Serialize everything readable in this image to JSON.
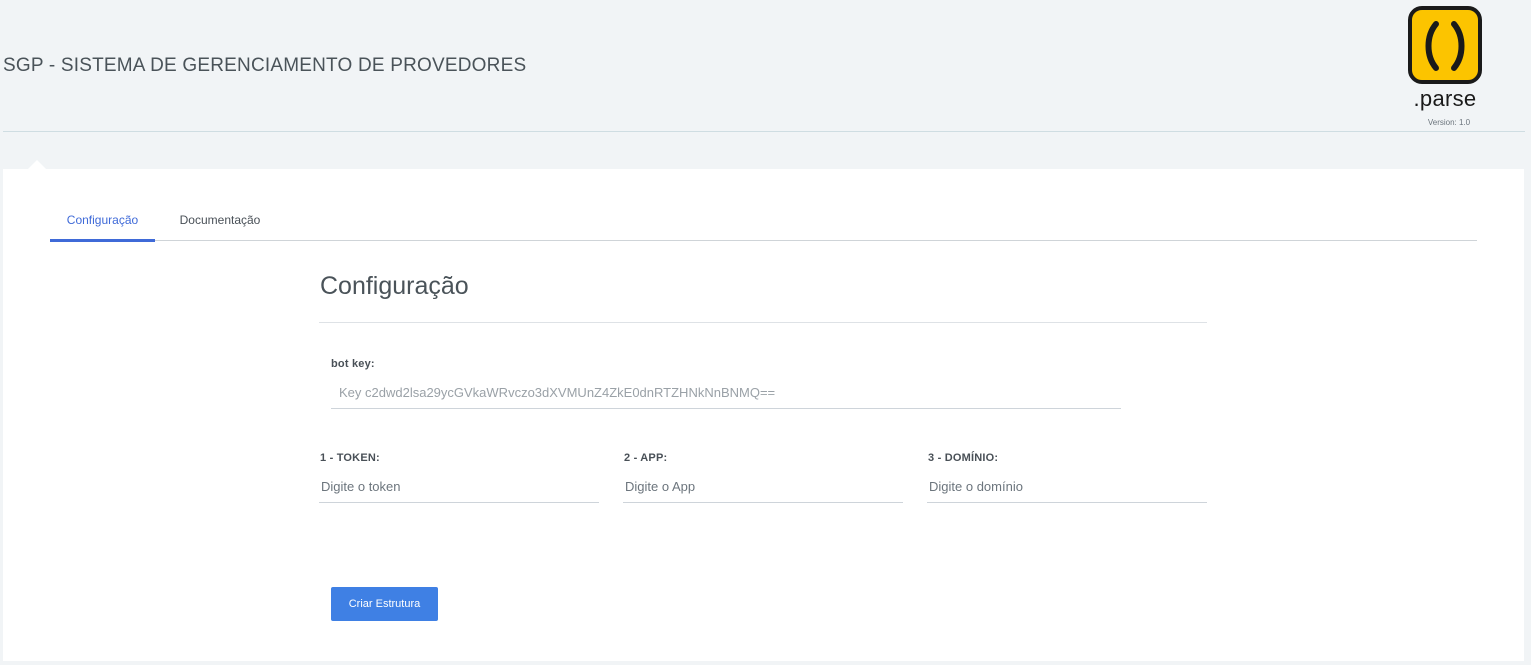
{
  "header": {
    "title": "SGP - SISTEMA DE GERENCIAMENTO DE PROVEDORES",
    "logo": {
      "wordmark": ".parse",
      "version": "Version: 1.0",
      "brand_color": "#fcc400"
    }
  },
  "tabs": [
    {
      "label": "Configuração",
      "active": true
    },
    {
      "label": "Documentação",
      "active": false
    }
  ],
  "form": {
    "title": "Configuração",
    "bot_key": {
      "label": "bot key:",
      "value": "Key c2dwd2lsa29ycGVkaWRvczo3dXVMUnZ4ZkE0dnRTZHNkNnBNMQ=="
    },
    "token": {
      "label": "1 - TOKEN:",
      "placeholder": "Digite o token"
    },
    "app": {
      "label": "2 - APP:",
      "placeholder": "Digite o App"
    },
    "domain": {
      "label": "3 - DOMÍNIO:",
      "placeholder": "Digite o domínio"
    },
    "submit_label": "Criar Estrutura"
  },
  "colors": {
    "accent": "#3f6ad8",
    "button": "#3f80e4",
    "page_background": "#f1f4f6",
    "card_background": "#ffffff"
  }
}
